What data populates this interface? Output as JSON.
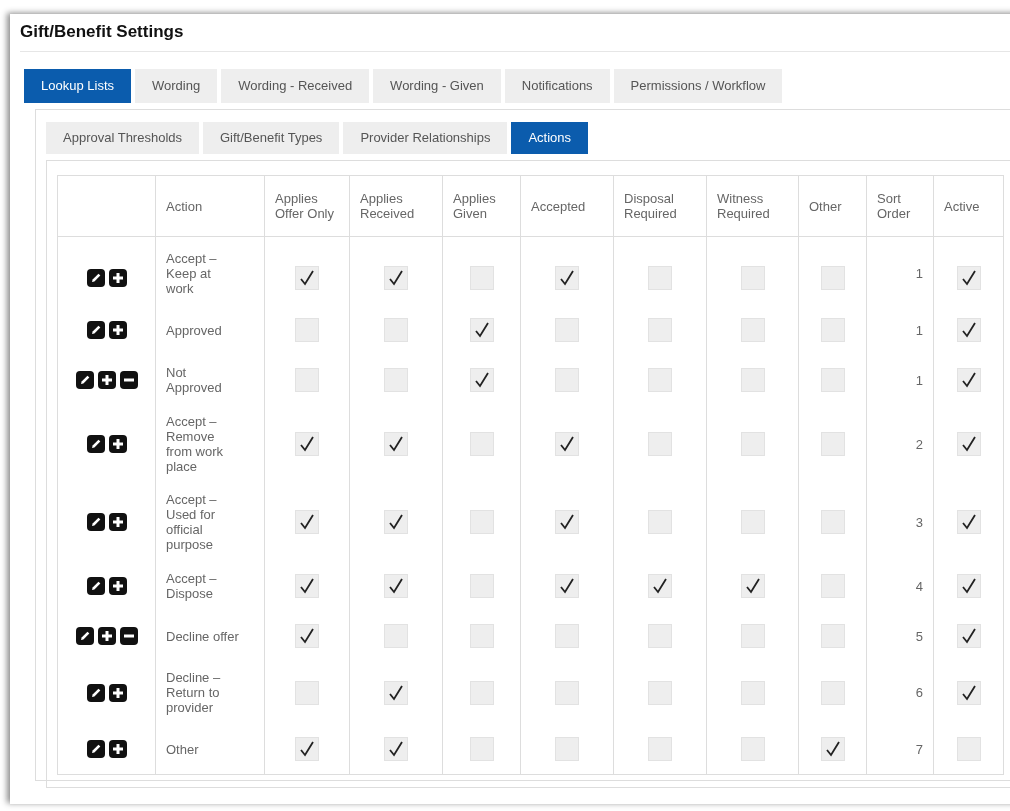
{
  "title": "Gift/Benefit Settings",
  "tabs": [
    {
      "label": "Lookup Lists",
      "selected": true
    },
    {
      "label": "Wording",
      "selected": false
    },
    {
      "label": "Wording - Received",
      "selected": false
    },
    {
      "label": "Wording - Given",
      "selected": false
    },
    {
      "label": "Notifications",
      "selected": false
    },
    {
      "label": "Permissions / Workflow",
      "selected": false
    }
  ],
  "subtabs": [
    {
      "label": "Approval Thresholds",
      "selected": false
    },
    {
      "label": "Gift/Benefit Types",
      "selected": false
    },
    {
      "label": "Provider Relationships",
      "selected": false
    },
    {
      "label": "Actions",
      "selected": true
    }
  ],
  "table": {
    "columns": [
      "Action",
      "Applies Offer Only",
      "Applies Received",
      "Applies Given",
      "Accepted",
      "Disposal Required",
      "Witness Required",
      "Other",
      "Sort Order",
      "Active"
    ],
    "rows": [
      {
        "action": "Accept – Keep at work",
        "can_delete": false,
        "checks": [
          true,
          true,
          false,
          true,
          false,
          false,
          false
        ],
        "sort_order": "1",
        "active": true
      },
      {
        "action": "Approved",
        "can_delete": false,
        "checks": [
          false,
          false,
          true,
          false,
          false,
          false,
          false
        ],
        "sort_order": "1",
        "active": true
      },
      {
        "action": "Not Approved",
        "can_delete": true,
        "checks": [
          false,
          false,
          true,
          false,
          false,
          false,
          false
        ],
        "sort_order": "1",
        "active": true
      },
      {
        "action": "Accept – Remove from work place",
        "can_delete": false,
        "checks": [
          true,
          true,
          false,
          true,
          false,
          false,
          false
        ],
        "sort_order": "2",
        "active": true
      },
      {
        "action": "Accept – Used for official purpose",
        "can_delete": false,
        "checks": [
          true,
          true,
          false,
          true,
          false,
          false,
          false
        ],
        "sort_order": "3",
        "active": true
      },
      {
        "action": "Accept – Dispose",
        "can_delete": false,
        "checks": [
          true,
          true,
          false,
          true,
          true,
          true,
          false
        ],
        "sort_order": "4",
        "active": true
      },
      {
        "action": "Decline offer",
        "can_delete": true,
        "checks": [
          true,
          false,
          false,
          false,
          false,
          false,
          false
        ],
        "sort_order": "5",
        "active": true
      },
      {
        "action": "Decline – Return to provider",
        "can_delete": false,
        "checks": [
          false,
          true,
          false,
          false,
          false,
          false,
          false
        ],
        "sort_order": "6",
        "active": true
      },
      {
        "action": "Other",
        "can_delete": false,
        "checks": [
          true,
          true,
          false,
          false,
          false,
          false,
          true
        ],
        "sort_order": "7",
        "active": false
      }
    ]
  }
}
